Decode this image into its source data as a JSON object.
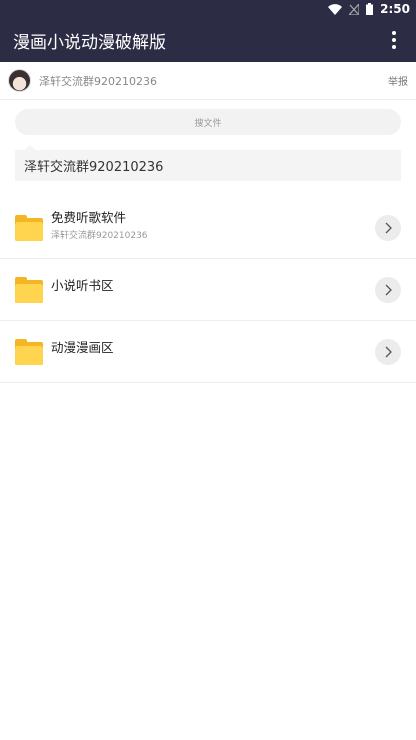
{
  "status_bar": {
    "time": "2:50"
  },
  "app_bar": {
    "title": "漫画小说动漫破解版"
  },
  "owner": {
    "name": "泽轩交流群920210236",
    "report_label": "举报"
  },
  "search": {
    "label": "搜文件"
  },
  "notice": {
    "text": "泽轩交流群920210236"
  },
  "folders": [
    {
      "title": "免费听歌软件",
      "subtitle": "泽轩交流群920210236"
    },
    {
      "title": "小说听书区",
      "subtitle": ""
    },
    {
      "title": "动漫漫画区",
      "subtitle": ""
    }
  ],
  "colors": {
    "app_bar": "#2c2d45",
    "folder": "#ffd54f"
  }
}
